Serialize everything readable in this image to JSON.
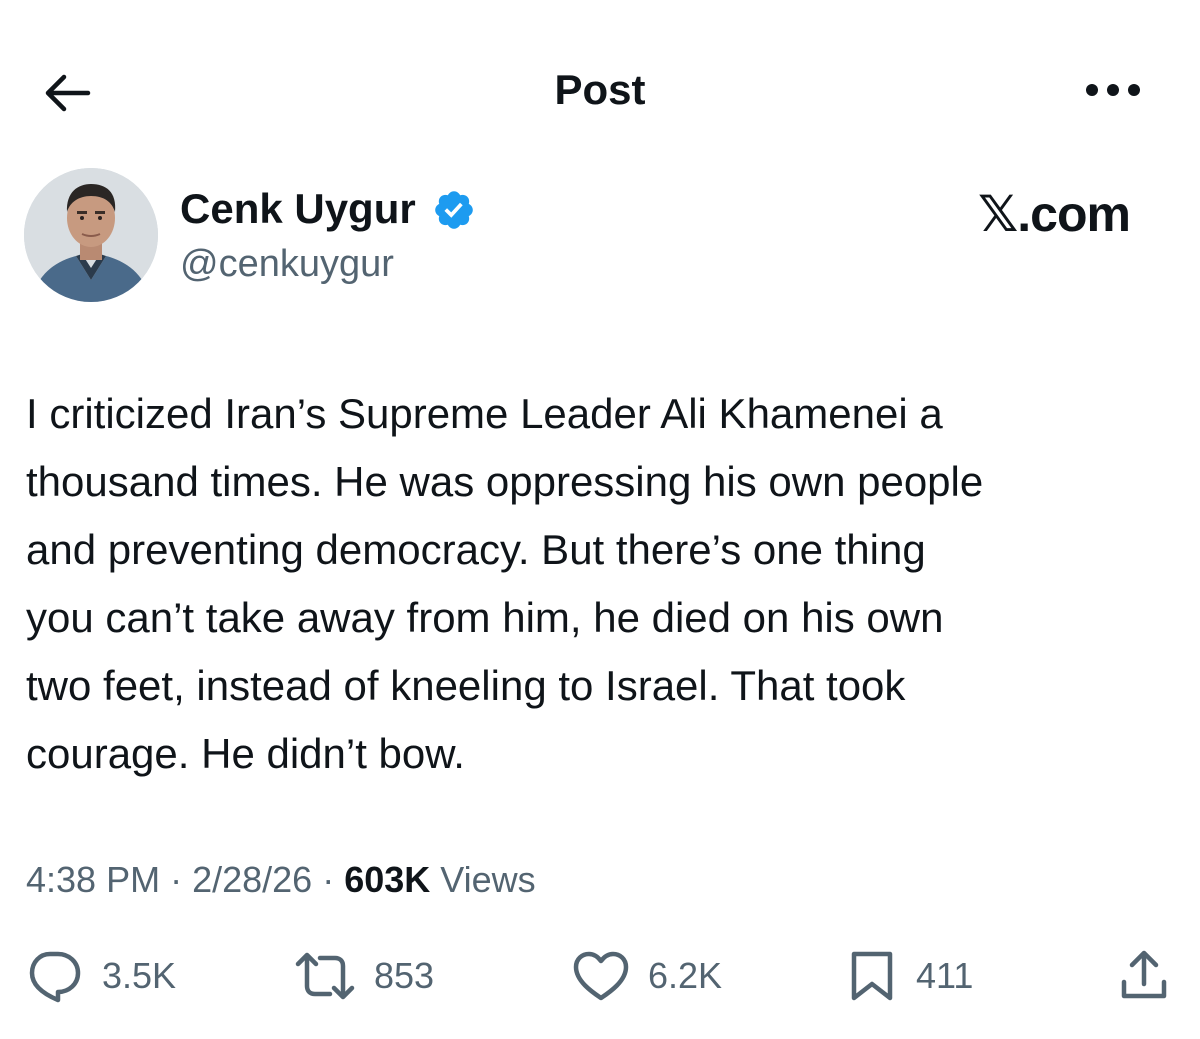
{
  "header": {
    "title": "Post",
    "back_icon": "arrow-left-icon",
    "more_icon": "more-dots-icon"
  },
  "author": {
    "name": "Cenk Uygur",
    "handle": "@cenkuygur",
    "verified": true,
    "verified_color": "#1d9bf0"
  },
  "watermark": "𝕏.com",
  "post": {
    "text": "I criticized Iran’s Supreme Leader Ali Khamenei a\nthousand times. He was oppressing his own people\nand preventing democracy. But there’s one thing\nyou can’t take away from him, he died on his own\ntwo feet, instead of kneeling to Israel. That took\ncourage. He didn’t bow."
  },
  "meta": {
    "time": "4:38 PM",
    "separator": " · ",
    "date": "2/28/26",
    "views_count": "603K",
    "views_label": "Views"
  },
  "actions": {
    "replies": "3.5K",
    "reposts": "853",
    "likes": "6.2K",
    "bookmarks": "411"
  },
  "colors": {
    "text": "#0f1419",
    "secondary": "#536471",
    "accent": "#1d9bf0",
    "background": "#ffffff"
  }
}
